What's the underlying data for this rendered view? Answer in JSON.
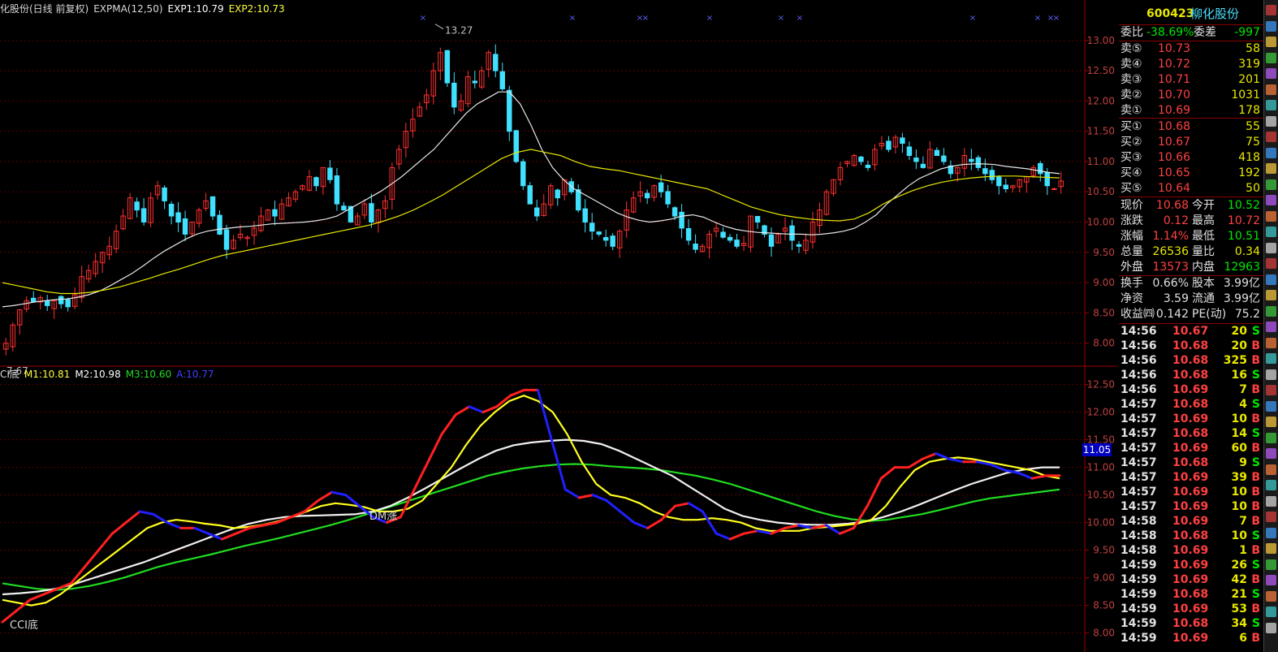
{
  "upper_legend": {
    "title": "化股份(日线 前复权)",
    "indicator": "EXPMA(12,50)",
    "exp1": "EXP1:10.79",
    "exp2": "EXP2:10.73"
  },
  "lower_legend": {
    "title": "CI底",
    "m1": "M1:10.81",
    "m2": "M2:10.98",
    "m3": "M3:10.60",
    "a": "A:10.77"
  },
  "annotations": {
    "high": "13.27",
    "low": "7.67",
    "dm": "DM涨",
    "cci": "CCI底",
    "cursor_value": "11.05"
  },
  "chart_data": [
    {
      "type": "line",
      "title": "",
      "series_kind": "candlestick",
      "y_ticks": [
        "13.00",
        "12.50",
        "12.00",
        "11.50",
        "11.00",
        "10.50",
        "10.00",
        "9.50",
        "9.00",
        "8.50",
        "8.00"
      ],
      "ylim": [
        7.7,
        13.4
      ],
      "high": 13.27,
      "low": 7.67,
      "closes": [
        8.0,
        8.3,
        8.55,
        8.7,
        8.68,
        8.75,
        8.62,
        8.7,
        8.65,
        8.6,
        8.8,
        9.1,
        9.2,
        9.35,
        9.5,
        9.6,
        9.85,
        10.1,
        10.4,
        10.2,
        10.0,
        10.4,
        10.6,
        10.35,
        10.1,
        10.0,
        9.8,
        10.0,
        10.2,
        10.35,
        10.1,
        9.8,
        9.55,
        9.7,
        9.8,
        9.75,
        9.9,
        10.1,
        10.2,
        10.1,
        10.3,
        10.4,
        10.5,
        10.6,
        10.75,
        10.6,
        10.9,
        10.7,
        10.3,
        10.2,
        10.0,
        10.1,
        10.3,
        10.0,
        10.2,
        10.35,
        10.9,
        11.2,
        11.5,
        11.7,
        11.9,
        12.1,
        12.5,
        12.8,
        12.3,
        11.9,
        12.0,
        12.4,
        12.3,
        12.5,
        12.8,
        12.5,
        12.2,
        11.5,
        11.0,
        10.6,
        10.3,
        10.1,
        10.3,
        10.6,
        10.4,
        10.7,
        10.5,
        10.2,
        10.0,
        9.85,
        9.8,
        9.7,
        9.6,
        9.85,
        10.2,
        10.4,
        10.5,
        10.4,
        10.6,
        10.5,
        10.3,
        10.1,
        9.9,
        9.7,
        9.55,
        9.6,
        9.8,
        9.9,
        9.75,
        9.7,
        9.6,
        9.65,
        10.1,
        10.0,
        9.8,
        9.6,
        9.8,
        9.9,
        9.7,
        9.6,
        9.7,
        10.0,
        10.2,
        10.5,
        10.7,
        10.9,
        11.0,
        11.1,
        11.0,
        10.9,
        11.2,
        11.3,
        11.2,
        11.4,
        11.3,
        11.1,
        11.0,
        10.9,
        11.2,
        11.1,
        11.0,
        10.8,
        10.9,
        11.1,
        11.0,
        10.9,
        10.8,
        10.7,
        10.6,
        10.55,
        10.6,
        10.7,
        10.75,
        10.9,
        10.8,
        10.6,
        10.55,
        10.68
      ],
      "exp1": [
        8.6,
        8.62,
        8.65,
        8.68,
        8.7,
        8.72,
        8.73,
        8.76,
        8.8,
        8.86,
        8.95,
        9.05,
        9.15,
        9.27,
        9.4,
        9.52,
        9.62,
        9.72,
        9.8,
        9.85,
        9.88,
        9.9,
        9.92,
        9.93,
        9.95,
        9.97,
        9.98,
        9.99,
        10.0,
        10.02,
        10.05,
        10.1,
        10.2,
        10.3,
        10.4,
        10.5,
        10.62,
        10.75,
        10.9,
        11.05,
        11.2,
        11.4,
        11.6,
        11.8,
        11.95,
        12.05,
        12.15,
        12.15,
        11.95,
        11.6,
        11.2,
        10.9,
        10.7,
        10.55,
        10.45,
        10.35,
        10.25,
        10.15,
        10.08,
        10.03,
        10.0,
        10.02,
        10.05,
        10.1,
        10.12,
        10.08,
        10.0,
        9.93,
        9.88,
        9.85,
        9.83,
        9.82,
        9.81,
        9.8,
        9.8,
        9.79,
        9.8,
        9.82,
        9.85,
        9.9,
        10.0,
        10.12,
        10.3,
        10.45,
        10.6,
        10.72,
        10.8,
        10.88,
        10.92,
        10.95,
        10.96,
        10.96,
        10.95,
        10.92,
        10.9,
        10.88,
        10.85,
        10.82,
        10.8
      ],
      "exp2": [
        9.0,
        8.95,
        8.9,
        8.85,
        8.82,
        8.82,
        8.84,
        8.88,
        8.93,
        9.0,
        9.07,
        9.15,
        9.22,
        9.3,
        9.38,
        9.45,
        9.5,
        9.55,
        9.6,
        9.65,
        9.7,
        9.75,
        9.8,
        9.85,
        9.9,
        9.95,
        10.02,
        10.1,
        10.2,
        10.32,
        10.45,
        10.6,
        10.75,
        10.9,
        11.05,
        11.15,
        11.2,
        11.15,
        11.1,
        11.0,
        10.92,
        10.88,
        10.85,
        10.8,
        10.75,
        10.7,
        10.65,
        10.6,
        10.55,
        10.45,
        10.35,
        10.25,
        10.18,
        10.12,
        10.08,
        10.05,
        10.03,
        10.02,
        10.05,
        10.15,
        10.3,
        10.42,
        10.52,
        10.6,
        10.66,
        10.7,
        10.73,
        10.75,
        10.76,
        10.76,
        10.75,
        10.74,
        10.73
      ]
    },
    {
      "type": "line",
      "title": "",
      "y_ticks": [
        "12.50",
        "12.00",
        "11.50",
        "11.00",
        "10.50",
        "10.00",
        "9.50",
        "9.00",
        "8.50",
        "8.00"
      ],
      "ylim": [
        7.7,
        12.7
      ],
      "series": [
        {
          "name": "M1",
          "color": "#ff2020",
          "values": [
            8.2,
            8.4,
            8.6,
            8.7,
            8.8,
            8.9,
            9.2,
            9.5,
            9.8,
            10.0,
            10.2,
            10.15,
            10.0,
            9.9,
            9.9,
            9.8,
            9.7,
            9.8,
            9.9,
            9.95,
            10.0,
            10.1,
            10.2,
            10.4,
            10.55,
            10.5,
            10.3,
            10.1,
            10.0,
            10.1,
            10.6,
            11.1,
            11.6,
            11.95,
            12.1,
            12.0,
            12.1,
            12.3,
            12.4,
            12.4,
            11.5,
            10.6,
            10.45,
            10.5,
            10.4,
            10.2,
            10.0,
            9.9,
            10.05,
            10.3,
            10.35,
            10.2,
            9.8,
            9.7,
            9.8,
            9.85,
            9.8,
            9.9,
            9.95,
            9.9,
            9.95,
            9.8,
            9.9,
            10.3,
            10.8,
            11.0,
            11.0,
            11.15,
            11.25,
            11.15,
            11.1,
            11.1,
            11.05,
            10.95,
            10.9,
            10.8,
            10.85,
            10.85
          ]
        },
        {
          "name": "M2",
          "color": "#ffff20",
          "values": [
            8.6,
            8.55,
            8.5,
            8.55,
            8.7,
            8.9,
            9.1,
            9.3,
            9.5,
            9.7,
            9.9,
            10.0,
            10.05,
            10.02,
            9.98,
            9.95,
            9.9,
            9.92,
            9.96,
            10.02,
            10.1,
            10.2,
            10.3,
            10.35,
            10.32,
            10.28,
            10.2,
            10.2,
            10.25,
            10.4,
            10.7,
            11.0,
            11.4,
            11.75,
            12.0,
            12.2,
            12.3,
            12.2,
            12.0,
            11.6,
            11.1,
            10.7,
            10.5,
            10.45,
            10.35,
            10.2,
            10.1,
            10.05,
            10.05,
            10.08,
            10.05,
            10.0,
            9.9,
            9.85,
            9.85,
            9.85,
            9.9,
            9.92,
            9.95,
            9.98,
            10.05,
            10.3,
            10.65,
            10.95,
            11.1,
            11.15,
            11.18,
            11.15,
            11.1,
            11.05,
            11.0,
            10.95,
            10.85,
            10.8
          ]
        },
        {
          "name": "A",
          "color": "#3030ff",
          "values": []
        },
        {
          "name": "M3",
          "color": "#20dd20",
          "values": [
            8.9,
            8.85,
            8.8,
            8.78,
            8.8,
            8.85,
            8.92,
            9.0,
            9.1,
            9.2,
            9.28,
            9.35,
            9.42,
            9.5,
            9.58,
            9.65,
            9.72,
            9.8,
            9.88,
            9.96,
            10.05,
            10.15,
            10.25,
            10.35,
            10.45,
            10.55,
            10.65,
            10.75,
            10.85,
            10.92,
            10.98,
            11.02,
            11.05,
            11.06,
            11.05,
            11.02,
            11.0,
            10.98,
            10.95,
            10.9,
            10.85,
            10.78,
            10.7,
            10.6,
            10.5,
            10.4,
            10.3,
            10.2,
            10.12,
            10.06,
            10.03,
            10.05,
            10.1,
            10.15,
            10.22,
            10.3,
            10.38,
            10.44,
            10.48,
            10.52,
            10.56,
            10.6
          ]
        },
        {
          "name": "white",
          "color": "#f0f0f0",
          "values": [
            8.7,
            8.72,
            8.75,
            8.8,
            8.88,
            8.98,
            9.08,
            9.18,
            9.28,
            9.4,
            9.52,
            9.64,
            9.76,
            9.88,
            9.98,
            10.05,
            10.1,
            10.12,
            10.13,
            10.14,
            10.15,
            10.2,
            10.3,
            10.45,
            10.62,
            10.8,
            10.98,
            11.15,
            11.3,
            11.4,
            11.45,
            11.48,
            11.5,
            11.48,
            11.42,
            11.3,
            11.15,
            11.0,
            10.85,
            10.65,
            10.45,
            10.25,
            10.12,
            10.05,
            10.0,
            9.97,
            9.96,
            9.96,
            9.98,
            10.02,
            10.1,
            10.2,
            10.32,
            10.45,
            10.58,
            10.7,
            10.8,
            10.9,
            10.96,
            11.0,
            11.0
          ]
        }
      ]
    }
  ],
  "side_panel": {
    "code": "600423",
    "name": "柳化股份",
    "weibi_label": "委比",
    "weibi_value": "-38.69%",
    "weicha_label": "委差",
    "weicha_value": "-997",
    "asks": [
      {
        "label": "卖⑤",
        "price": "10.73",
        "vol": "58"
      },
      {
        "label": "卖④",
        "price": "10.72",
        "vol": "319"
      },
      {
        "label": "卖③",
        "price": "10.71",
        "vol": "201"
      },
      {
        "label": "卖②",
        "price": "10.70",
        "vol": "1031"
      },
      {
        "label": "卖①",
        "price": "10.69",
        "vol": "178"
      }
    ],
    "bids": [
      {
        "label": "买①",
        "price": "10.68",
        "vol": "55"
      },
      {
        "label": "买②",
        "price": "10.67",
        "vol": "75"
      },
      {
        "label": "买③",
        "price": "10.66",
        "vol": "418"
      },
      {
        "label": "买④",
        "price": "10.65",
        "vol": "192"
      },
      {
        "label": "买⑤",
        "price": "10.64",
        "vol": "50"
      }
    ],
    "stats": [
      {
        "l1": "现价",
        "v1": "10.68",
        "c1": "red",
        "l2": "今开",
        "v2": "10.52",
        "c2": "green"
      },
      {
        "l1": "涨跌",
        "v1": "0.12",
        "c1": "red",
        "l2": "最高",
        "v2": "10.72",
        "c2": "red"
      },
      {
        "l1": "涨幅",
        "v1": "1.14%",
        "c1": "red",
        "l2": "最低",
        "v2": "10.51",
        "c2": "green"
      },
      {
        "l1": "总量",
        "v1": "26536",
        "c1": "yellow",
        "l2": "量比",
        "v2": "0.34",
        "c2": "yellow"
      },
      {
        "l1": "外盘",
        "v1": "13573",
        "c1": "red",
        "l2": "内盘",
        "v2": "12963",
        "c2": "green"
      }
    ],
    "finance": [
      {
        "l1": "换手",
        "v1": "0.66%",
        "l2": "股本",
        "v2": "3.99亿"
      },
      {
        "l1": "净资",
        "v1": "3.59",
        "l2": "流通",
        "v2": "3.99亿"
      },
      {
        "l1": "收益㈣",
        "v1": "0.142",
        "l2": "PE(动)",
        "v2": "75.2"
      }
    ],
    "ticks": [
      {
        "t": "14:56",
        "p": "10.67",
        "pc": "red",
        "v": "20",
        "s": "S"
      },
      {
        "t": "14:56",
        "p": "10.68",
        "pc": "red",
        "v": "20",
        "s": "B"
      },
      {
        "t": "14:56",
        "p": "10.68",
        "pc": "red",
        "v": "325",
        "s": "B"
      },
      {
        "t": "14:56",
        "p": "10.68",
        "pc": "red",
        "v": "16",
        "s": "S"
      },
      {
        "t": "14:56",
        "p": "10.69",
        "pc": "red",
        "v": "7",
        "s": "B"
      },
      {
        "t": "14:57",
        "p": "10.68",
        "pc": "red",
        "v": "4",
        "s": "S"
      },
      {
        "t": "14:57",
        "p": "10.69",
        "pc": "red",
        "v": "10",
        "s": "B"
      },
      {
        "t": "14:57",
        "p": "10.68",
        "pc": "red",
        "v": "14",
        "s": "S"
      },
      {
        "t": "14:57",
        "p": "10.69",
        "pc": "red",
        "v": "60",
        "s": "B"
      },
      {
        "t": "14:57",
        "p": "10.68",
        "pc": "red",
        "v": "9",
        "s": "S"
      },
      {
        "t": "14:57",
        "p": "10.69",
        "pc": "red",
        "v": "39",
        "s": "B"
      },
      {
        "t": "14:57",
        "p": "10.69",
        "pc": "red",
        "v": "10",
        "s": "B"
      },
      {
        "t": "14:57",
        "p": "10.69",
        "pc": "red",
        "v": "10",
        "s": "B"
      },
      {
        "t": "14:58",
        "p": "10.69",
        "pc": "red",
        "v": "7",
        "s": "B"
      },
      {
        "t": "14:58",
        "p": "10.68",
        "pc": "red",
        "v": "10",
        "s": "S"
      },
      {
        "t": "14:58",
        "p": "10.69",
        "pc": "red",
        "v": "1",
        "s": "B"
      },
      {
        "t": "14:59",
        "p": "10.69",
        "pc": "red",
        "v": "26",
        "s": "S"
      },
      {
        "t": "14:59",
        "p": "10.69",
        "pc": "red",
        "v": "42",
        "s": "B"
      },
      {
        "t": "14:59",
        "p": "10.68",
        "pc": "red",
        "v": "21",
        "s": "S"
      },
      {
        "t": "14:59",
        "p": "10.69",
        "pc": "red",
        "v": "53",
        "s": "B"
      },
      {
        "t": "14:59",
        "p": "10.68",
        "pc": "red",
        "v": "34",
        "s": "S"
      },
      {
        "t": "14:59",
        "p": "10.69",
        "pc": "red",
        "v": "6",
        "s": "B"
      }
    ]
  }
}
